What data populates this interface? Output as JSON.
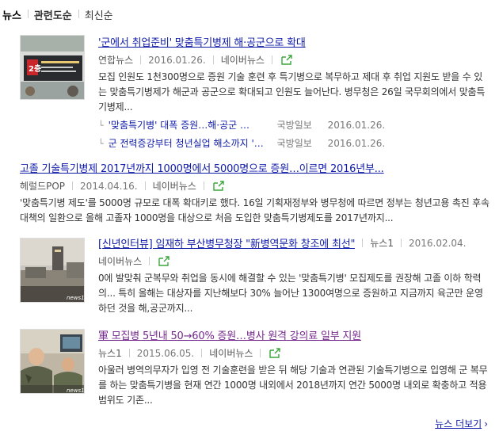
{
  "tabs": [
    "뉴스",
    "관련도순",
    "최신순"
  ],
  "articles": [
    {
      "title": "'군에서 취업준비' 맞춤특기병제 해·공군으로 확대",
      "source": "연합뉴스",
      "date": "2016.01.26.",
      "portal": "네이버뉴스",
      "desc": "모집 인원도 1천300명으로 증원 기술 훈련 후 특기병으로 복무하고 제대 후 취업 지원도 받을 수 있는 맞춤특기병제가 해군과 공군으로 확대되고 인원도 늘어난다. 병무청은 26일 국무회의에서 맞춤특기병제...",
      "related": [
        {
          "title": "'맞춤특기병' 대폭 증원…해·공군 …",
          "source": "국방일보",
          "date": "2016.01.26."
        },
        {
          "title": "군 전력증강부터 청년실업 해소까지 '…",
          "source": "국방일보",
          "date": "2016.01.26."
        }
      ]
    },
    {
      "title": "고졸 기술특기병제 2017년까지 1000명에서 5000명으로 증원…이르면 2016년부...",
      "source": "헤럴드POP",
      "date": "2014.04.16.",
      "portal": "네이버뉴스",
      "desc": "'맞춤특기병 제도'를 5000명 규모로 대폭 확대키로 했다. 16일 기획재정부와 병무청에 따르면 정부는 청년고용 촉진 후속 대책의 일환으로 올해 고졸자 1000명을 대상으로 처음 도입한 맞춤특기병제도를 2017년까지..."
    },
    {
      "title": "[신년인터뷰] 임재하 부산병무청장 \"新병역문화 창조에 최선\"",
      "source": "뉴스1",
      "date": "2016.02.04.",
      "portal": "네이버뉴스",
      "desc": "0에 발맞춰 군복무와 취업을 동시에 해결할 수 있는 '맞춤특기병' 모집제도를 권장해 고졸 이하 학력의... 특히 올해는 대상자를 지난해보다 30% 늘어난 1300여명으로 증원하고 지금까지 육군만 운영하던 것을 해,공군까지...",
      "thumb_badge": "news1"
    },
    {
      "title": "軍 모집병 5년내 50→60% 증원…병사 원격 강의료 일부 지원",
      "source": "뉴스1",
      "date": "2015.06.05.",
      "portal": "네이버뉴스",
      "desc": "아울러 병역의무자가 입영 전 기술훈련을 받은 뒤 해당 기술과 연관된 기술특기병으로 입영해 군 복무를 하는 맞춤특기병을 현재 연간 1000명 내외에서 2018년까지 연간 5000명 내외로 확충하고 적용 범위도 기존...",
      "thumb_badge": "news1"
    }
  ],
  "more_label": "뉴스 더보기",
  "colors": {
    "title_link": "#0f1ba8",
    "visited_link": "#772a8e",
    "share_icon": "#3aa63a"
  },
  "icons": [
    "share-icon",
    "related-arrow-icon",
    "chevron-right-icon"
  ]
}
